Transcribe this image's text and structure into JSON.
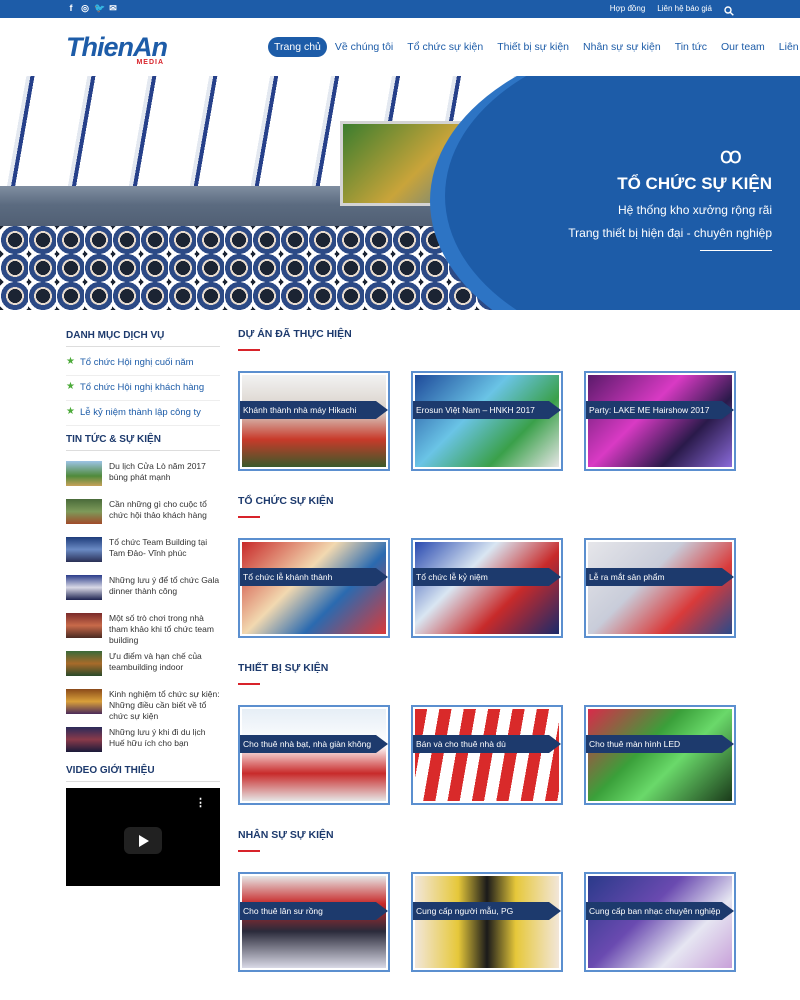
{
  "topbar": {
    "social": [
      "f",
      "◎",
      "🐦",
      "✉"
    ],
    "links": [
      "Hợp đồng",
      "Liên hệ báo giá"
    ]
  },
  "logo": {
    "name": "ThienAn",
    "sub": "MEDIA"
  },
  "nav": [
    "Trang chủ",
    "Về chúng tôi",
    "Tổ chức sự kiện",
    "Thiết bị sự kiện",
    "Nhân sự sự kiện",
    "Tin tức",
    "Our team",
    "Liên hệ"
  ],
  "banner": {
    "flourish": "ꝏ",
    "title": "TỔ CHỨC SỰ KIỆN",
    "line1": "Hệ thống kho xưởng rộng rãi",
    "line2": "Trang thiết bị hiện đại - chuyên nghiệp"
  },
  "sidebar": {
    "services_title": "DANH MỤC DỊCH VỤ",
    "services": [
      "Tổ chức Hội nghị cuối năm",
      "Tổ chức Hội nghị khách hàng",
      "Lễ kỷ niệm thành lập công ty"
    ],
    "news_title": "TIN TỨC & SỰ KIỆN",
    "news": [
      "Du lịch Cửa Lò năm 2017 bùng phát mạnh",
      "Cần những gì cho cuộc tổ chức hội thảo khách hàng",
      "Tổ chức Team Building tại Tam Đảo- Vĩnh phúc",
      "Những lưu ý để tổ chức Gala dinner thành công",
      "Một số trò chơi trong nhà tham khảo khi tổ chức team building",
      "Ưu điểm và hạn chế của teambuilding indoor",
      "Kinh nghiệm tổ chức sự kiện: Những điều cần biết về tổ chức sự kiện",
      "Những lưu ý khi đi du lịch Huế hữu ích cho bạn"
    ],
    "video_title": "VIDEO GIỚI THIỆU"
  },
  "sections": [
    {
      "title": "DỰ ÁN ĐÃ THỰC HIỆN",
      "cards": [
        "Khánh thành nhà máy Hikachi",
        "Erosun Việt Nam – HNKH 2017",
        "Party: LAKE ME Hairshow 2017"
      ]
    },
    {
      "title": "TỔ CHỨC SỰ KIỆN",
      "cards": [
        "Tổ chức lễ khánh thành",
        "Tổ chức lễ kỷ niệm",
        "Lễ ra mắt sản phẩm"
      ]
    },
    {
      "title": "THIẾT BỊ SỰ KIỆN",
      "cards": [
        "Cho thuê nhà bạt, nhà giàn không gian",
        "Bán và cho thuê nhà dù",
        "Cho thuê màn hình LED"
      ]
    },
    {
      "title": "NHÂN SỰ SỰ KIỆN",
      "cards": [
        "Cho thuê lân sư rồng",
        "Cung cấp người mẫu, PG",
        "Cung cấp ban nhạc chuyên nghiệp"
      ]
    }
  ],
  "colors": {
    "primary": "#1d5ca8",
    "dark": "#1d3a6d",
    "accent": "#d8232a",
    "star": "#4caa3a"
  }
}
